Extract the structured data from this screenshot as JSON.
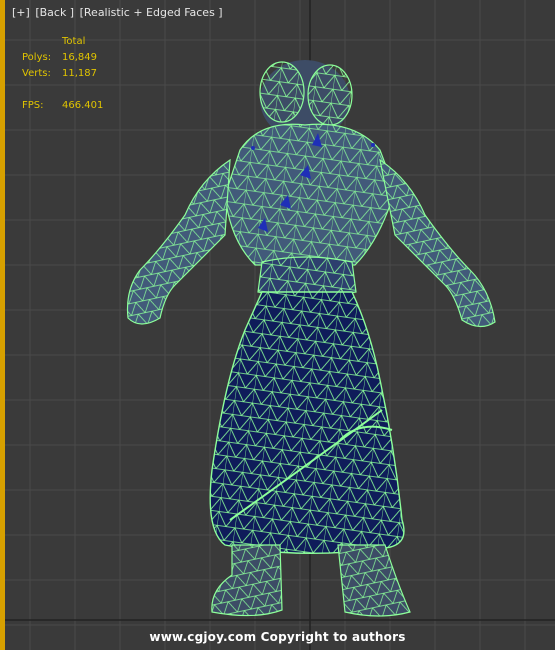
{
  "viewport": {
    "label_parts": [
      "[+]",
      "[Back ]",
      "[Realistic + Edged Faces ]"
    ]
  },
  "stats": {
    "header": "Total",
    "polys_label": "Polys:",
    "polys_value": "16,849",
    "verts_label": "Verts:",
    "verts_value": "11,187",
    "fps_label": "FPS:",
    "fps_value": "466.401"
  },
  "footer": {
    "credit": "www.cgjoy.com Copyright to authors"
  },
  "colors": {
    "grid": "#4a4a4a",
    "grid_major": "#222222",
    "wire": "#8dff9a",
    "mesh_fill": "#0f1c5a",
    "skin_fill": "#3a4a6a",
    "stats_text": "#e0c400",
    "border": "#d7a000"
  }
}
